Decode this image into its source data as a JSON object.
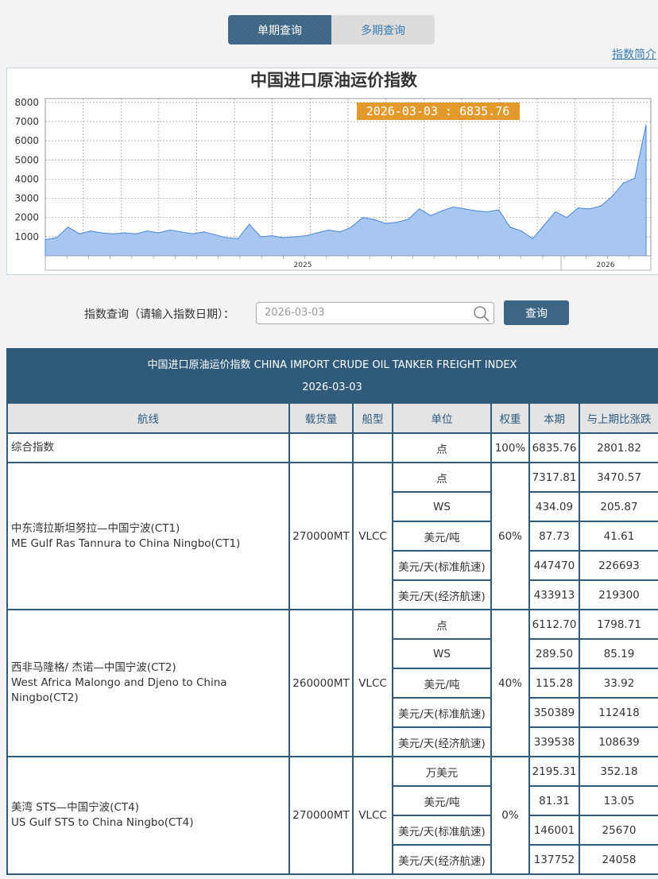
{
  "tabs": [
    {
      "label": "单期查询",
      "active": true
    },
    {
      "label": "多期查询",
      "active": false
    }
  ],
  "intro_link": "指数简介",
  "chart_data": {
    "type": "area",
    "title": "中国进口原油运价指数",
    "tooltip": "2026-03-03 : 6835.76",
    "ylim": [
      0,
      8200
    ],
    "yticks": [
      1000,
      2000,
      3000,
      4000,
      5000,
      6000,
      7000,
      8000
    ],
    "ytick_labels": [
      "1000",
      "2000",
      "3000",
      "4000",
      "5000",
      "6000",
      "7000",
      "8000"
    ],
    "xtick_labels": [
      "2025",
      "2026"
    ],
    "grid": true,
    "fill_color": "#a7c7f0",
    "line_color": "#4a86d8",
    "x": [
      "2024-02",
      "2024-03",
      "2024-03",
      "2024-04",
      "2024-04",
      "2024-05",
      "2024-05",
      "2024-06",
      "2024-06",
      "2024-07",
      "2024-07",
      "2024-08",
      "2024-08",
      "2024-09",
      "2024-09",
      "2024-10",
      "2024-10",
      "2024-11",
      "2024-11",
      "2024-12",
      "2024-12",
      "2025-01",
      "2025-01",
      "2025-02",
      "2025-02",
      "2025-03",
      "2025-03",
      "2025-04",
      "2025-04",
      "2025-05",
      "2025-05",
      "2025-06",
      "2025-06",
      "2025-07",
      "2025-07",
      "2025-08",
      "2025-08",
      "2025-09",
      "2025-09",
      "2025-10",
      "2025-10",
      "2025-11",
      "2025-11",
      "2025-12",
      "2025-12",
      "2026-01",
      "2026-01",
      "2026-02",
      "2026-02",
      "2026-03"
    ],
    "values": [
      850,
      950,
      1500,
      1150,
      1300,
      1200,
      1150,
      1200,
      1150,
      1300,
      1200,
      1350,
      1250,
      1150,
      1250,
      1100,
      950,
      900,
      1650,
      1000,
      1050,
      950,
      1000,
      1050,
      1200,
      1350,
      1250,
      1500,
      2000,
      1900,
      1700,
      1750,
      1900,
      2450,
      2100,
      2350,
      2550,
      2450,
      2350,
      2300,
      2400,
      1500,
      1300,
      900,
      1600,
      2300,
      2000,
      2500,
      2450,
      2600,
      3100,
      3800,
      4050,
      6835.76
    ]
  },
  "query": {
    "label": "指数查询（请输入指数日期）：",
    "input_value": "2026-03-03",
    "button_label": "查询"
  },
  "table": {
    "title": "中国进口原油运价指数 CHINA IMPORT CRUDE OIL TANKER FREIGHT INDEX",
    "date": "2026-03-03",
    "headers": [
      "航线",
      "载货量",
      "船型",
      "单位",
      "权重",
      "本期",
      "与上期比涨跌"
    ],
    "composite": {
      "route": "综合指数",
      "cargo": "",
      "ship": "",
      "unit": "点",
      "weight": "100%",
      "current": "6835.76",
      "change": "2801.82"
    },
    "groups": [
      {
        "route_cn": "中东湾拉斯坦努拉—中国宁波(CT1)",
        "route_en": "ME Gulf Ras Tannura to China Ningbo(CT1)",
        "cargo": "270000MT",
        "ship": "VLCC",
        "weight": "60%",
        "rows": [
          {
            "unit": "点",
            "current": "7317.81",
            "change": "3470.57"
          },
          {
            "unit": "WS",
            "current": "434.09",
            "change": "205.87"
          },
          {
            "unit": "美元/吨",
            "current": "87.73",
            "change": "41.61"
          },
          {
            "unit": "美元/天(标准航速)",
            "current": "447470",
            "change": "226693"
          },
          {
            "unit": "美元/天(经济航速)",
            "current": "433913",
            "change": "219300"
          }
        ]
      },
      {
        "route_cn": "西非马隆格/ 杰诺—中国宁波(CT2)",
        "route_en": "West Africa Malongo and Djeno to China Ningbo(CT2)",
        "cargo": "260000MT",
        "ship": "VLCC",
        "weight": "40%",
        "rows": [
          {
            "unit": "点",
            "current": "6112.70",
            "change": "1798.71"
          },
          {
            "unit": "WS",
            "current": "289.50",
            "change": "85.19"
          },
          {
            "unit": "美元/吨",
            "current": "115.28",
            "change": "33.92"
          },
          {
            "unit": "美元/天(标准航速)",
            "current": "350389",
            "change": "112418"
          },
          {
            "unit": "美元/天(经济航速)",
            "current": "339538",
            "change": "108639"
          }
        ]
      },
      {
        "route_cn": "美湾 STS—中国宁波(CT4)",
        "route_en": "US Gulf STS to China Ningbo(CT4)",
        "cargo": "270000MT",
        "ship": "VLCC",
        "weight": "0%",
        "rows": [
          {
            "unit": "万美元",
            "current": "2195.31",
            "change": "352.18"
          },
          {
            "unit": "美元/吨",
            "current": "81.31",
            "change": "13.05"
          },
          {
            "unit": "美元/天(标准航速)",
            "current": "146001",
            "change": "25670"
          },
          {
            "unit": "美元/天(经济航速)",
            "current": "137752",
            "change": "24058"
          }
        ]
      }
    ]
  }
}
